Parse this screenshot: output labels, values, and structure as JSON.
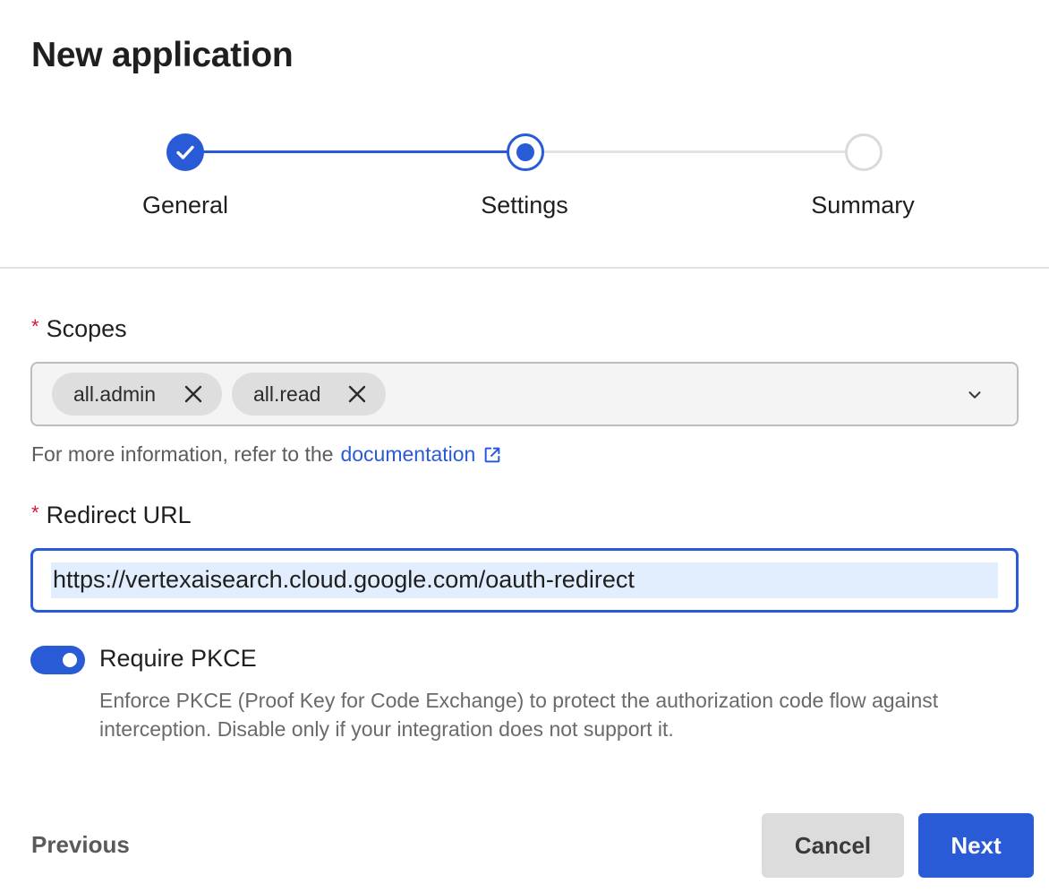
{
  "page": {
    "title": "New application"
  },
  "stepper": {
    "steps": [
      {
        "label": "General",
        "state": "completed"
      },
      {
        "label": "Settings",
        "state": "current"
      },
      {
        "label": "Summary",
        "state": "upcoming"
      }
    ]
  },
  "scopes": {
    "required_marker": "*",
    "label": "Scopes",
    "selected": [
      "all.admin",
      "all.read"
    ],
    "help_text": "For more information, refer to the",
    "help_link": "documentation"
  },
  "redirect": {
    "required_marker": "*",
    "label": "Redirect URL",
    "value": "https://vertexaisearch.cloud.google.com/oauth-redirect"
  },
  "pkce": {
    "label": "Require PKCE",
    "enabled": true,
    "description": "Enforce PKCE (Proof Key for Code Exchange) to protect the authorization code flow against interception. Disable only if your integration does not support it."
  },
  "footer": {
    "previous_label": "Previous",
    "cancel_label": "Cancel",
    "next_label": "Next"
  },
  "colors": {
    "accent": "#2a5bd7",
    "required": "#d0183a"
  }
}
